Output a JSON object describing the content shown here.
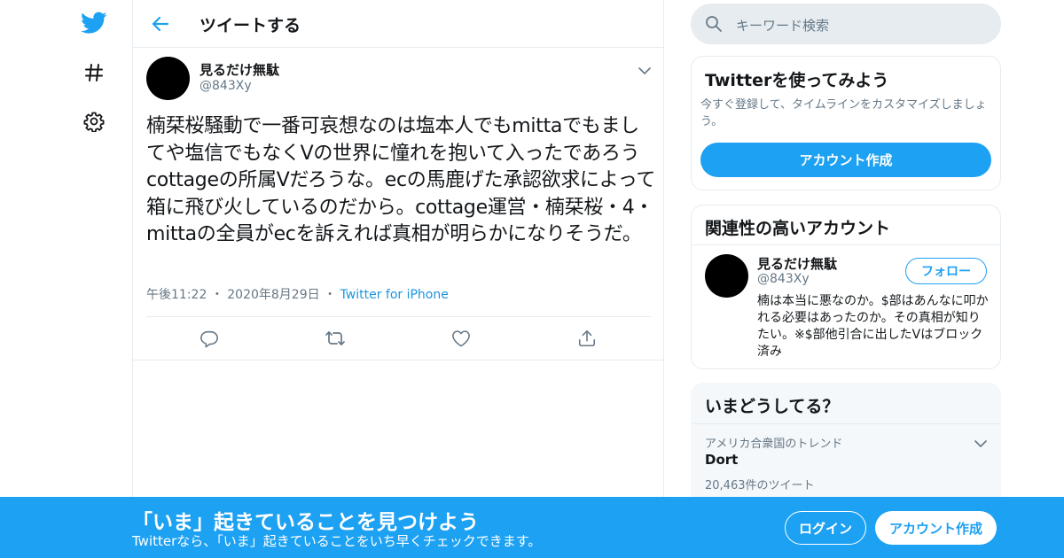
{
  "header": {
    "title": "ツイートする"
  },
  "tweet": {
    "author_name": "見るだけ無駄",
    "author_handle": "@843Xy",
    "text": "楠栞桜騒動で一番可哀想なのは塩本人でもmittaでもましてや塩信でもなくVの世界に憧れを抱いて入ったであろうcottageの所属Vだろうな。ecの馬鹿げた承認欲求によって箱に飛び火しているのだから。cottage運営・楠栞桜・4・mittaの全員がecを訴えれば真相が明らかになりそうだ。",
    "time": "午後11:22",
    "date": "2020年8月29日",
    "separator": "・",
    "source": "Twitter for iPhone"
  },
  "search": {
    "placeholder": "キーワード検索"
  },
  "signup_card": {
    "title": "Twitterを使ってみよう",
    "description": "今すぐ登録して、タイムラインをカスタマイズしましょう。",
    "button": "アカウント作成"
  },
  "related_card": {
    "title": "関連性の高いアカウント",
    "account": {
      "name": "見るだけ無駄",
      "handle": "@843Xy",
      "follow": "フォロー",
      "bio": "楠は本当に悪なのか。$部はあんなに叩かれる必要はあったのか。その真相が知りたい。※$部他引合に出したVはブロック済み"
    }
  },
  "trends_card": {
    "title": "いまどうしてる？",
    "trend": {
      "location": "アメリカ合衆国のトレンド",
      "name": "Dort",
      "count": "20,463件のツイート"
    }
  },
  "banner": {
    "title": "「いま」起きていることを見つけよう",
    "subtitle": "Twitterなら、「いま」起きていることをいち早くチェックできます。",
    "login": "ログイン",
    "signup": "アカウント作成"
  },
  "colors": {
    "accent": "#1da1f2",
    "muted": "#657786",
    "border": "#e6ecf0"
  },
  "icons": [
    "twitter-bird-icon",
    "hashtag-icon",
    "gear-icon",
    "back-arrow-icon",
    "chevron-down-icon",
    "reply-icon",
    "retweet-icon",
    "like-icon",
    "share-icon",
    "search-icon"
  ]
}
